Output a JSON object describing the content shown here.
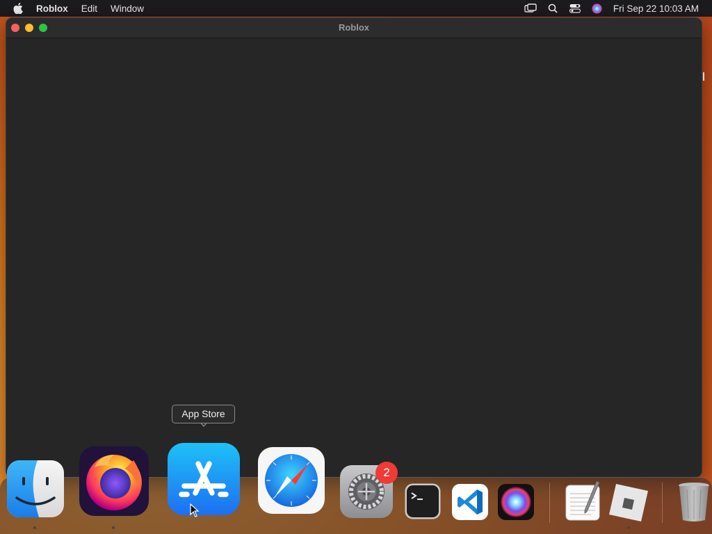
{
  "menubar": {
    "app_name": "Roblox",
    "items": [
      "Edit",
      "Window"
    ],
    "clock": "Fri Sep 22  10:03 AM",
    "icons": [
      "apple-icon",
      "screen-mirroring-icon",
      "spotlight-search-icon",
      "control-center-icon",
      "siri-icon"
    ]
  },
  "window": {
    "title": "Roblox"
  },
  "dock": {
    "tooltip": "App Store",
    "apps": [
      "Finder",
      "Firefox",
      "App Store",
      "Safari",
      "System Settings",
      "Terminal",
      "Visual Studio Code",
      "Siri",
      "TextEdit",
      "Roblox",
      "Trash"
    ],
    "settings_badge": "2"
  },
  "colors": {
    "menubar_bg": "#1c1c1e",
    "window_bg": "#262626",
    "badge": "#ef3b34"
  }
}
